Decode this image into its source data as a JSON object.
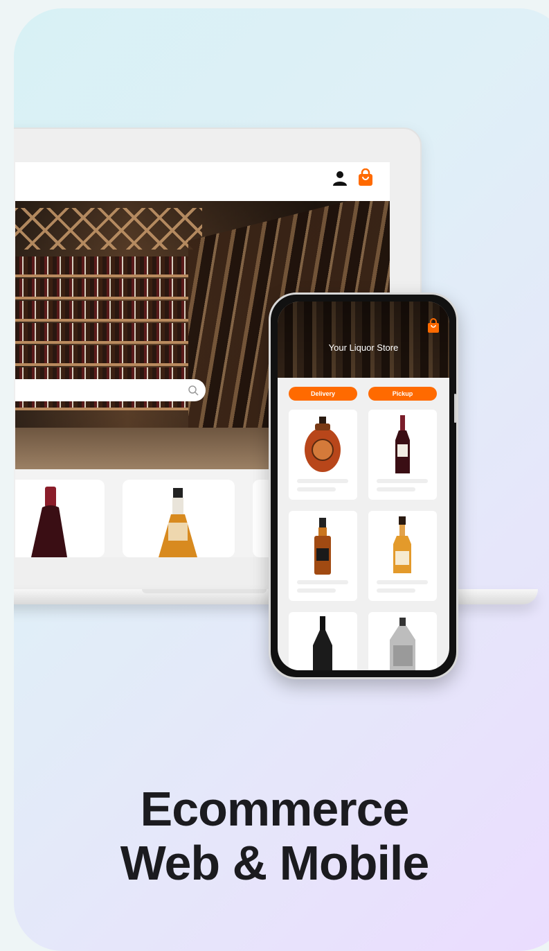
{
  "desktop": {
    "header": {
      "icons": [
        "user-icon",
        "shopping-bag-icon"
      ]
    },
    "search": {
      "placeholder": ""
    },
    "product_cards": [
      "red wine bottle",
      "whisky bottle",
      "partial card"
    ]
  },
  "mobile": {
    "header": {
      "title": "Your Liquor Store",
      "icons": [
        "shopping-bag-icon"
      ]
    },
    "tabs": [
      {
        "label": "Delivery"
      },
      {
        "label": "Pickup"
      }
    ],
    "products": [
      "cognac bottle",
      "red wine bottle",
      "bourbon bottle",
      "whisky bottle",
      "champagne bottle",
      "clear spirit bottle"
    ]
  },
  "caption": {
    "line1": "Ecommerce",
    "line2": "Web & Mobile"
  },
  "colors": {
    "accent": "#ff6a00",
    "text_dark": "#1b1b1f",
    "card_gradient_start": "#d8f1f5",
    "card_gradient_end": "#ebdcff"
  }
}
